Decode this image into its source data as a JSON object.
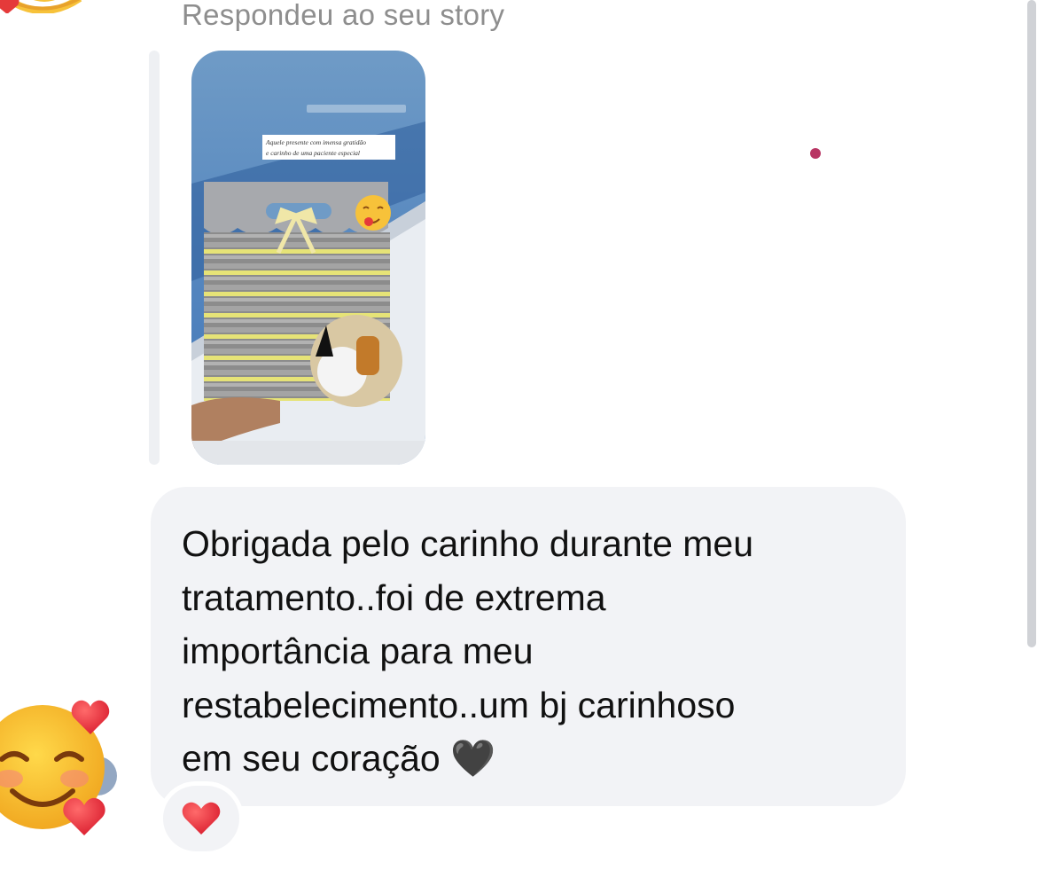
{
  "thread": {
    "replied_label": "Respondeu ao seu story",
    "story_preview": {
      "caption_line1": "Aquele presente com imensa gratidão",
      "caption_line2": "e carinho de uma paciente especial"
    },
    "message": {
      "text": "Obrigada pelo carinho durante meu\ntratamento..foi de extrema\nimportância para meu\nrestabelecimento..um bj carinhoso\nem seu coração 🖤"
    },
    "reaction": {
      "icon": "red-heart-icon",
      "color": "#e0223a"
    },
    "avatar": {
      "icon": "smiling-face-with-hearts-icon"
    },
    "accent_dot_color": "#b83563"
  }
}
